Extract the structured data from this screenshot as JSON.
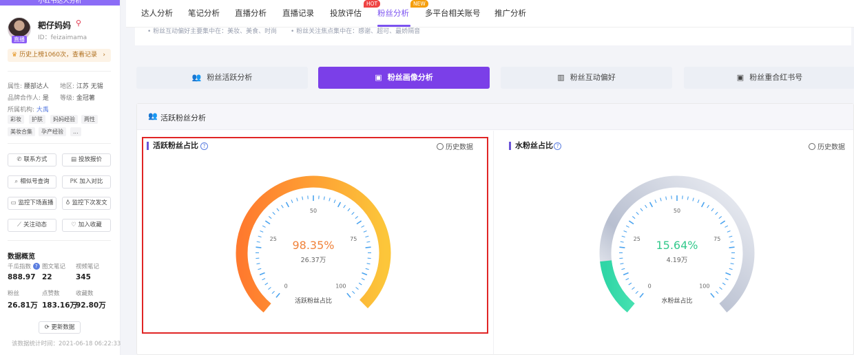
{
  "sidebar": {
    "top_label": "小红书达人分析",
    "name": "耙仔妈妈",
    "id_text": "ID：feizaimama",
    "live_badge": "直播",
    "history": "历史上榜1060次，查看记录",
    "attrs": {
      "attr_label": "属性:",
      "attr_value": "腰部达人",
      "region_label": "地区:",
      "region_value": "江苏 无锡",
      "brand_label": "品牌合作人:",
      "brand_value": "是",
      "level_label": "等级:",
      "level_value": "金冠薯",
      "org_label": "所属机构:",
      "org_value": "大禹"
    },
    "tags": [
      "彩妆",
      "护肤",
      "妈妈经验",
      "两性",
      "美妆合集",
      "孕产经验",
      "..."
    ],
    "buttons": [
      "联系方式",
      "投放报价",
      "相似号查询",
      "加入对比",
      "监控下场直播",
      "监控下次发文",
      "关注动态",
      "加入收藏"
    ],
    "pk_prefix": "PK",
    "overview": {
      "title": "数据概览",
      "items": [
        {
          "label": "千瓜指数",
          "value": "888.97"
        },
        {
          "label": "图文笔记",
          "value": "22"
        },
        {
          "label": "视频笔记",
          "value": "345"
        },
        {
          "label": "粉丝",
          "value": "26.81万"
        },
        {
          "label": "点赞数",
          "value": "183.16万"
        },
        {
          "label": "收藏数",
          "value": "92.80万"
        }
      ]
    },
    "update_button": "更新数据",
    "stat_time": "该数据统计时间：2021-06-18 06:22:33"
  },
  "nav": {
    "items": [
      "达人分析",
      "笔记分析",
      "直播分析",
      "直播记录",
      "投放评估",
      "粉丝分析",
      "多平台相关账号",
      "推广分析"
    ],
    "active": "粉丝分析",
    "hot_badge": "HOT",
    "new_badge": "NEW",
    "hot_color": "#ef4444",
    "new_color": "#f59e0b"
  },
  "strip": {
    "left_text": "• 粉丝互动偏好主要集中在：美妆、美食、时尚",
    "right_text": "• 粉丝关注焦点集中在：感谢、超可、最娇隔音"
  },
  "tabs": [
    "粉丝活跃分析",
    "粉丝画像分析",
    "粉丝互动偏好",
    "粉丝重合红书号"
  ],
  "active_tab": "粉丝画像分析",
  "panel": {
    "title": "活跃粉丝分析"
  },
  "cards": {
    "active": {
      "title": "活跃粉丝占比",
      "history": "历史数据",
      "percent_text": "98.35%",
      "percent_value": 98.35,
      "count": "26.37万",
      "caption": "活跃粉丝占比",
      "ticks": [
        "0",
        "25",
        "50",
        "75",
        "100"
      ],
      "color_start": "#ff7a2e",
      "color_end": "#fcc63a",
      "value_color": "#f0823a"
    },
    "water": {
      "title": "水粉丝占比",
      "history": "历史数据",
      "percent_text": "15.64%",
      "percent_value": 15.64,
      "count": "4.19万",
      "caption": "水粉丝占比",
      "ticks": [
        "0",
        "25",
        "50",
        "75",
        "100"
      ],
      "color_start": "#2fd6a6",
      "color_end": "#45e0b0",
      "rest_color": "#b8bfd0",
      "value_color": "#34c98c"
    },
    "tick_color": "#4aa3ef"
  }
}
